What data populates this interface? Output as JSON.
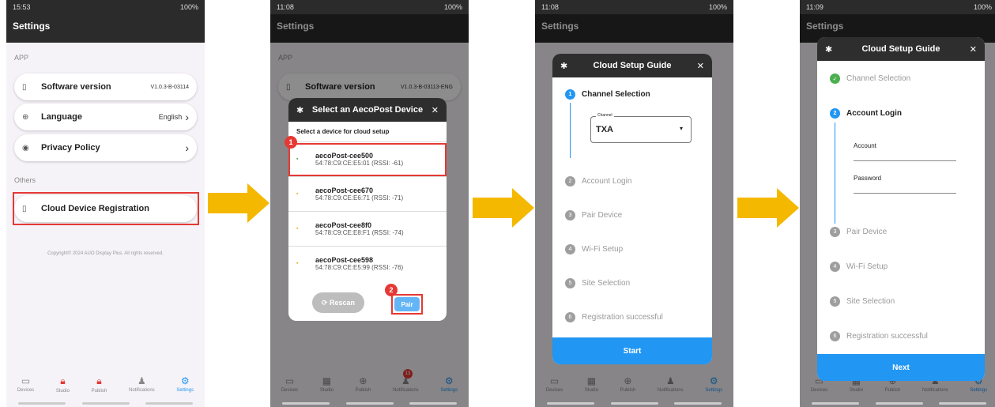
{
  "colors": {
    "accent": "#2196f3",
    "highlight": "#e53935",
    "arrow": "#f5b800"
  },
  "panel1": {
    "status_time": "15:53",
    "status_right": "100%",
    "title": "Settings",
    "section_app": "APP",
    "software_label": "Software version",
    "software_value": "V1.0.3-B-03114",
    "language_label": "Language",
    "language_value": "English",
    "privacy_label": "Privacy Policy",
    "section_others": "Others",
    "cloud_label": "Cloud Device Registration",
    "copyright": "Copyright© 2024 AUO Display Plus. All rights reserved.",
    "nav": [
      "Devices",
      "Studio",
      "Publish",
      "Notifications",
      "Settings"
    ]
  },
  "panel2": {
    "status_time": "11:08",
    "status_right": "100%",
    "title": "Settings",
    "section_app": "APP",
    "software_label": "Software version",
    "software_value": "V1.0.3-B-03113-ENG",
    "dialog_title": "Select an AecoPost Device",
    "dialog_subtitle": "Select a device for cloud setup",
    "devices": [
      {
        "name": "aecoPost-cee500",
        "mac": "54:78:C9:CE:E5:01",
        "rssi": "(RSSI: -61)"
      },
      {
        "name": "aecoPost-cee670",
        "mac": "54:78:C9:CE:E6:71",
        "rssi": "(RSSI: -71)"
      },
      {
        "name": "aecoPost-cee8f0",
        "mac": "54:78:C9:CE:E8:F1",
        "rssi": "(RSSI: -74)"
      },
      {
        "name": "aecoPost-cee598",
        "mac": "54:78:C9:CE:E5:99",
        "rssi": "(RSSI: -76)"
      }
    ],
    "rescan": "Rescan",
    "pair": "Pair",
    "badge1": "1",
    "badge2": "2",
    "nav": [
      "Devices",
      "Studio",
      "Publish",
      "Notifications",
      "Settings"
    ],
    "notif_count": "13"
  },
  "panel3": {
    "status_time": "11:08",
    "status_right": "100%",
    "title": "Settings",
    "dialog_title": "Cloud Setup Guide",
    "step1": "Channel Selection",
    "channel_label": "Channel",
    "channel_value": "TXA",
    "steps": [
      "Account Login",
      "Pair Device",
      "Wi-Fi Setup",
      "Site Selection",
      "Registration successful"
    ],
    "step_nums": [
      "1",
      "2",
      "3",
      "4",
      "5",
      "6"
    ],
    "start": "Start",
    "nav": [
      "Devices",
      "Studio",
      "Publish",
      "Notifications",
      "Settings"
    ]
  },
  "panel4": {
    "status_time": "11:09",
    "status_right": "100%",
    "title": "Settings",
    "dialog_title": "Cloud Setup Guide",
    "step1": "Channel Selection",
    "step2": "Account Login",
    "account_label": "Account",
    "password_label": "Password",
    "steps": [
      "Pair Device",
      "Wi-Fi Setup",
      "Site Selection",
      "Registration successful"
    ],
    "step_nums": [
      "2",
      "3",
      "4",
      "5",
      "6"
    ],
    "next": "Next",
    "nav": [
      "Devices",
      "Studio",
      "Publish",
      "Notifications",
      "Settings"
    ]
  }
}
